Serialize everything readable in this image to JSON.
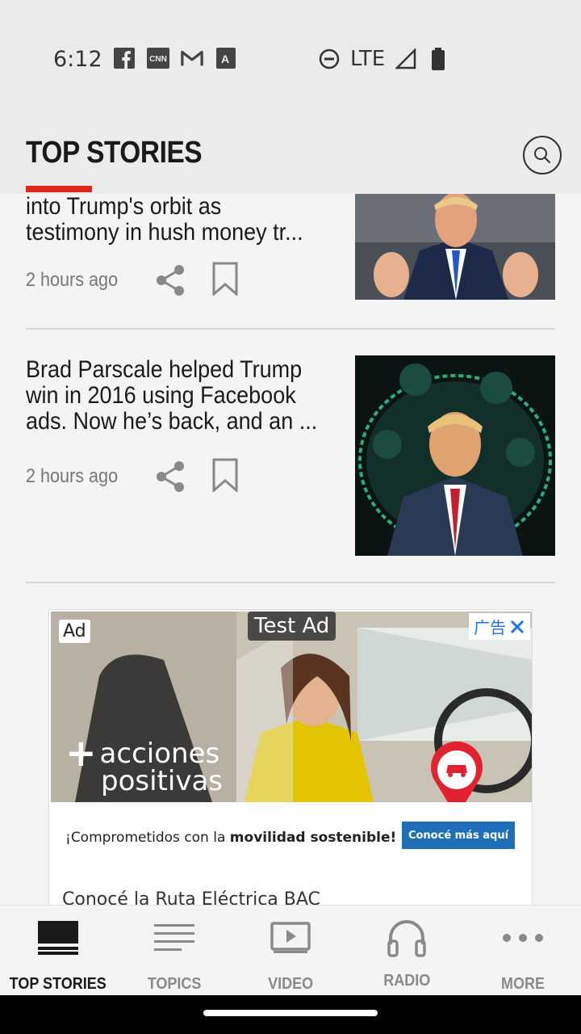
{
  "status_bar": {
    "time": "6:12",
    "network": "LTE",
    "left_icons": [
      "facebook-icon",
      "cnn-icon",
      "gmail-icon",
      "font-icon"
    ],
    "right_icons": [
      "do-not-disturb-icon",
      "signal-icon",
      "battery-icon"
    ]
  },
  "header": {
    "title": "TOP STORIES",
    "accent_color": "#e1251b"
  },
  "stories": [
    {
      "headline_line1": "into Trump's orbit as",
      "headline_line2": "testimony in hush money tr...",
      "time": "2 hours ago"
    },
    {
      "headline_line1": "Brad Parscale helped Trump",
      "headline_line2": "win in 2016 using Facebook",
      "headline_line3": "ads. Now he’s back, and an ...",
      "time": "2 hours ago"
    }
  ],
  "ad": {
    "badge": "Ad",
    "test_label": "Test Ad",
    "choice_label": "广告",
    "brand_line1": "acciones",
    "brand_line2": "positivas",
    "tagline_prefix": "¡Comprometidos con la ",
    "tagline_bold": "movilidad sostenible!",
    "cta": "Conocé más aquí",
    "subtext": "Conocé la Ruta Eléctrica BAC"
  },
  "bottom_nav": {
    "items": [
      {
        "label": "TOP STORIES",
        "icon": "top-stories-icon",
        "active": true
      },
      {
        "label": "TOPICS",
        "icon": "topics-icon",
        "active": false
      },
      {
        "label": "VIDEO",
        "icon": "video-icon",
        "active": false
      },
      {
        "label": "RADIO",
        "icon": "headphones-icon",
        "active": false
      },
      {
        "label": "MORE",
        "icon": "more-icon",
        "active": false
      }
    ]
  }
}
